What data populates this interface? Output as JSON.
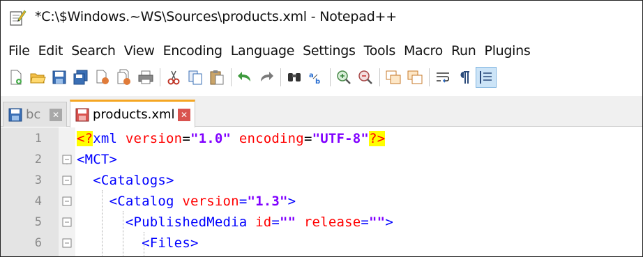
{
  "window": {
    "title": "*C:\\$Windows.~WS\\Sources\\products.xml - Notepad++",
    "icon": "notepad-plus-plus-icon"
  },
  "menu": [
    "File",
    "Edit",
    "Search",
    "View",
    "Encoding",
    "Language",
    "Settings",
    "Tools",
    "Macro",
    "Run",
    "Plugins"
  ],
  "toolbar": {
    "icons": [
      "new-file-icon",
      "open-file-icon",
      "save-icon",
      "save-all-icon",
      "close-icon",
      "close-all-icon",
      "print-icon",
      "cut-icon",
      "copy-icon",
      "paste-icon",
      "undo-icon",
      "redo-icon",
      "find-icon",
      "replace-icon",
      "zoom-in-icon",
      "zoom-out-icon",
      "sync-vertical-icon",
      "sync-horizontal-icon",
      "word-wrap-icon",
      "show-all-chars-icon",
      "indent-guide-icon"
    ]
  },
  "tabs": [
    {
      "label": "bc",
      "state": "inactive"
    },
    {
      "label": "products.xml",
      "state": "active"
    }
  ],
  "editor": {
    "line_numbers": [
      "1",
      "2",
      "3",
      "4",
      "5",
      "6"
    ],
    "lines": [
      {
        "tokens": [
          [
            "pi",
            "<?"
          ],
          [
            "name",
            "xml"
          ],
          [
            "plain",
            " "
          ],
          [
            "attr",
            "version"
          ],
          [
            "plain",
            "="
          ],
          [
            "str",
            "\"1.0\""
          ],
          [
            "plain",
            " "
          ],
          [
            "attr",
            "encoding"
          ],
          [
            "plain",
            "="
          ],
          [
            "str",
            "\"UTF-8\""
          ],
          [
            "pi",
            "?>"
          ]
        ]
      },
      {
        "tokens": [
          [
            "tag",
            "<MCT>"
          ]
        ]
      },
      {
        "tokens": [
          [
            "plain",
            "  "
          ],
          [
            "tag",
            "<Catalogs>"
          ]
        ]
      },
      {
        "tokens": [
          [
            "plain",
            "    "
          ],
          [
            "tag",
            "<Catalog "
          ],
          [
            "attr",
            "version"
          ],
          [
            "tag",
            "="
          ],
          [
            "str",
            "\"1.3\""
          ],
          [
            "tag",
            ">"
          ]
        ]
      },
      {
        "tokens": [
          [
            "plain",
            "      "
          ],
          [
            "tag",
            "<PublishedMedia "
          ],
          [
            "attr",
            "id"
          ],
          [
            "tag",
            "="
          ],
          [
            "str",
            "\"\""
          ],
          [
            "plain",
            " "
          ],
          [
            "attr",
            "release"
          ],
          [
            "tag",
            "="
          ],
          [
            "str",
            "\"\""
          ],
          [
            "tag",
            ">"
          ]
        ]
      },
      {
        "tokens": [
          [
            "plain",
            "        "
          ],
          [
            "tag",
            "<Files>"
          ]
        ]
      }
    ]
  }
}
